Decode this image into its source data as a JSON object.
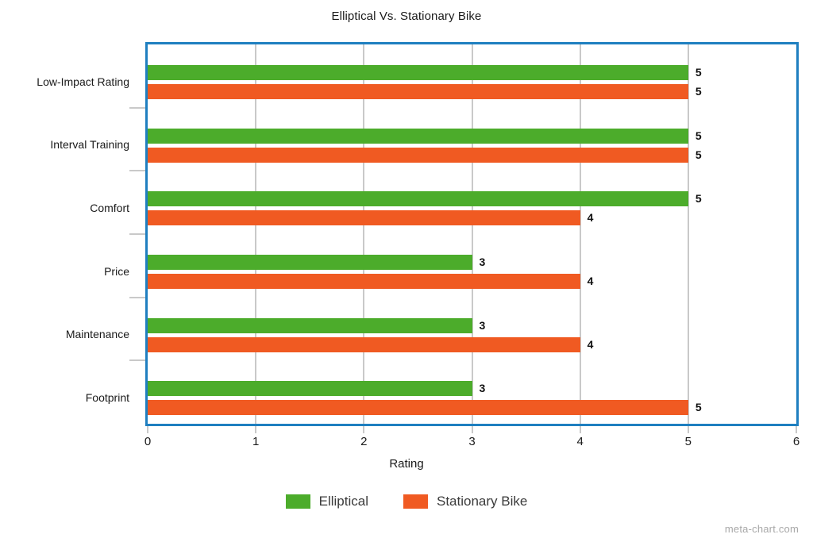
{
  "chart_data": {
    "type": "bar",
    "orientation": "horizontal",
    "title": "Elliptical Vs. Stationary Bike",
    "xlabel": "Rating",
    "ylabel": "",
    "xlim": [
      0,
      6
    ],
    "xticks": [
      "0",
      "1",
      "2",
      "3",
      "4",
      "5",
      "6"
    ],
    "grid": true,
    "legend_position": "bottom",
    "categories": [
      "Low-Impact Rating",
      "Interval Training",
      "Comfort",
      "Price",
      "Maintenance",
      "Footprint"
    ],
    "series": [
      {
        "name": "Elliptical",
        "color": "#4cac2b",
        "values": [
          5,
          5,
          5,
          3,
          3,
          3
        ],
        "value_labels": [
          "5",
          "5",
          "5",
          "3",
          "3",
          "3"
        ]
      },
      {
        "name": "Stationary Bike",
        "color": "#f05a22",
        "values": [
          5,
          5,
          4,
          4,
          4,
          5
        ],
        "value_labels": [
          "5",
          "5",
          "4",
          "4",
          "4",
          "5"
        ]
      }
    ]
  },
  "watermark": "meta-chart.com",
  "colors": {
    "plot_border": "#1f7fc0",
    "gridline": "#c9c9c9",
    "elliptical": "#4cac2b",
    "stationary_bike": "#f05a22",
    "text": "#1a1a1a",
    "watermark": "#a8a8a8"
  }
}
